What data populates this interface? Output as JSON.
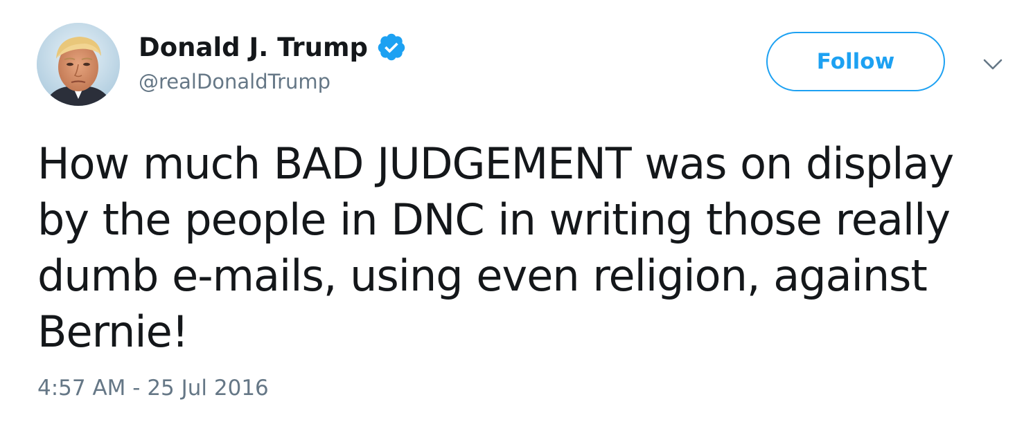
{
  "author": {
    "display_name": "Donald J. Trump",
    "handle": "@realDonaldTrump",
    "verified": true,
    "avatar_icon": "profile-photo"
  },
  "actions": {
    "follow_label": "Follow",
    "menu_icon": "chevron-down-icon"
  },
  "tweet": {
    "text": "How much BAD JUDGEMENT was on display by the people in DNC in writing those really dumb e-mails, using even religion, against Bernie!",
    "timestamp": "4:57 AM - 25 Jul 2016"
  },
  "colors": {
    "accent": "#1da1f2",
    "text_primary": "#14171a",
    "text_secondary": "#657786",
    "background": "#ffffff"
  }
}
